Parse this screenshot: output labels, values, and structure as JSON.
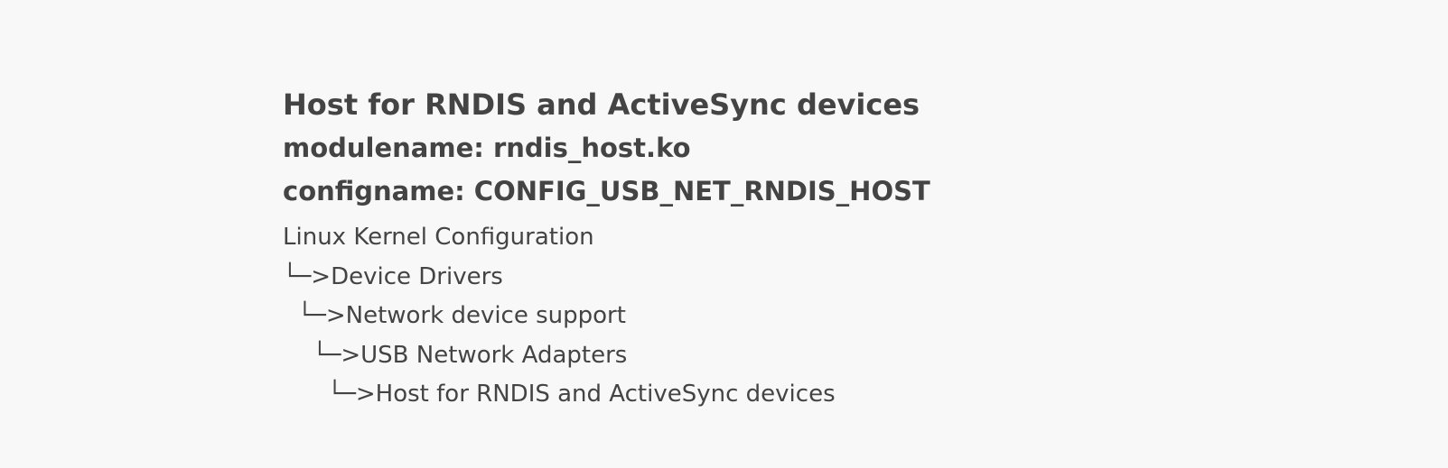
{
  "heading": {
    "title": "Host for RNDIS and ActiveSync devices",
    "modulename": "modulename: rndis_host.ko",
    "configname": "configname: CONFIG_USB_NET_RNDIS_HOST"
  },
  "menu_path": {
    "root": "Linux Kernel Configuration",
    "levels": [
      "└─>Device Drivers",
      "  └─>Network device support",
      "    └─>USB Network Adapters",
      "      └─>Host for RNDIS and ActiveSync devices"
    ]
  }
}
